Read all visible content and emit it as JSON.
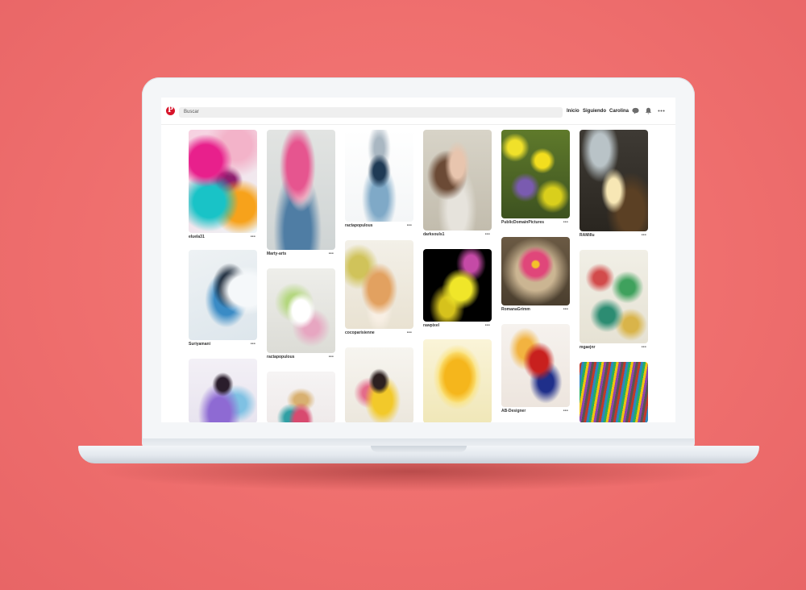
{
  "search": {
    "placeholder": "Buscar"
  },
  "nav": {
    "home": "Inicio",
    "following": "Siguiendo",
    "user": "Carolina"
  },
  "icons": {
    "logo": "pinterest-logo-icon",
    "messages": "chat-bubble-icon",
    "notifications": "bell-icon",
    "more": "more-dots-icon"
  },
  "colors": {
    "background": "#ef6f6e",
    "brand": "#d7142a"
  },
  "pins": [
    {
      "col": 0,
      "author": "eluela31"
    },
    {
      "col": 0,
      "author": "Suriyamani"
    },
    {
      "col": 0,
      "author": ""
    },
    {
      "col": 1,
      "author": "Marty-arts"
    },
    {
      "col": 1,
      "author": "ractapopulous"
    },
    {
      "col": 1,
      "author": ""
    },
    {
      "col": 2,
      "author": "ractapopulous"
    },
    {
      "col": 2,
      "author": "cocoparisienne"
    },
    {
      "col": 2,
      "author": ""
    },
    {
      "col": 3,
      "author": "darksouls1"
    },
    {
      "col": 3,
      "author": "rawpixel"
    },
    {
      "col": 3,
      "author": ""
    },
    {
      "col": 4,
      "author": "PublicDomainPictures"
    },
    {
      "col": 4,
      "author": "RomanaGrimm"
    },
    {
      "col": 4,
      "author": "AB-Designer"
    },
    {
      "col": 5,
      "author": "RAMillu"
    },
    {
      "col": 5,
      "author": "mgaejnr"
    },
    {
      "col": 5,
      "author": ""
    }
  ],
  "more_label": "•••"
}
